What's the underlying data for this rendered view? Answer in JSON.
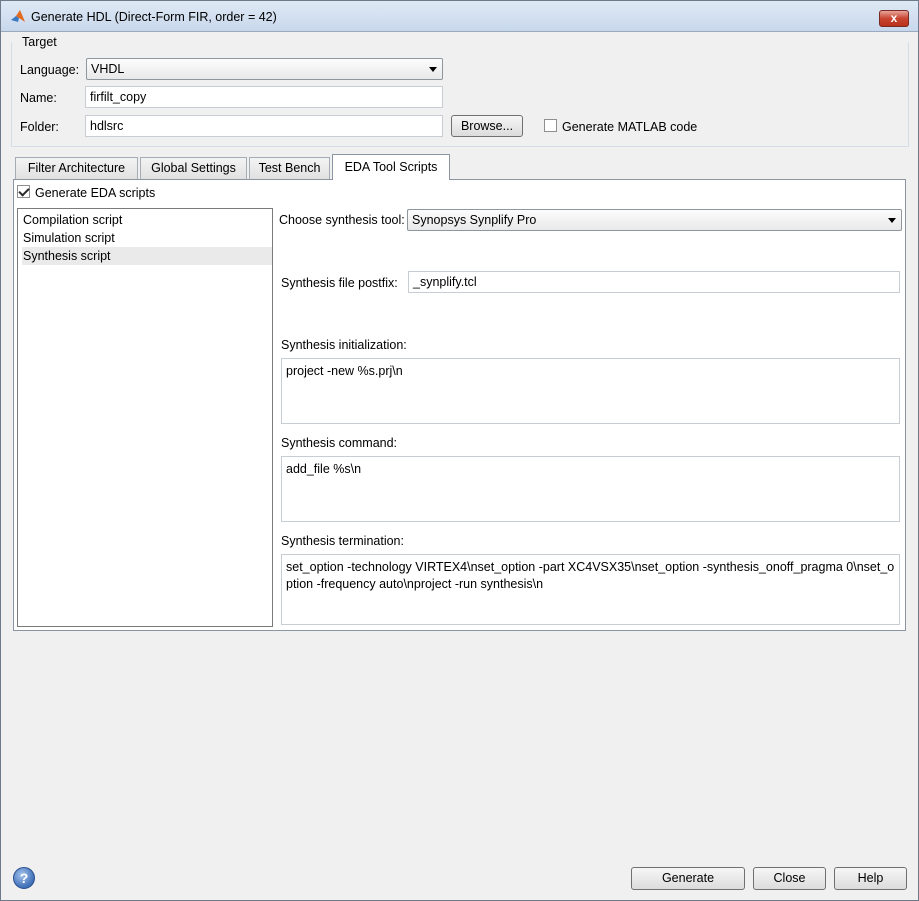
{
  "window": {
    "title": "Generate HDL (Direct-Form FIR, order = 42)",
    "close_label": "x"
  },
  "target": {
    "legend": "Target",
    "language_label": "Language:",
    "language_value": "VHDL",
    "name_label": "Name:",
    "name_value": "firfilt_copy",
    "folder_label": "Folder:",
    "folder_value": "hdlsrc",
    "browse_label": "Browse...",
    "generate_matlab_label": "Generate MATLAB code",
    "generate_matlab_checked": false
  },
  "tabs": [
    {
      "label": "Filter Architecture"
    },
    {
      "label": "Global Settings"
    },
    {
      "label": "Test Bench"
    },
    {
      "label": "EDA Tool Scripts"
    }
  ],
  "eda": {
    "generate_label": "Generate EDA scripts",
    "generate_checked": true,
    "scripts": [
      {
        "label": "Compilation script"
      },
      {
        "label": "Simulation script"
      },
      {
        "label": "Synthesis script"
      }
    ],
    "choose_tool_label": "Choose synthesis tool:",
    "tool_value": "Synopsys Synplify Pro",
    "postfix_label": "Synthesis file postfix:",
    "postfix_value": "_synplify.tcl",
    "init_label": "Synthesis initialization:",
    "init_value": "project -new %s.prj\\n",
    "command_label": "Synthesis command:",
    "command_value": "add_file %s\\n",
    "termination_label": "Synthesis termination:",
    "termination_value": "set_option -technology VIRTEX4\\nset_option -part XC4VSX35\\nset_option -synthesis_onoff_pragma 0\\nset_option -frequency auto\\nproject -run synthesis\\n"
  },
  "footer": {
    "help_icon_glyph": "?",
    "generate_label": "Generate",
    "close_label": "Close",
    "help_label": "Help"
  }
}
